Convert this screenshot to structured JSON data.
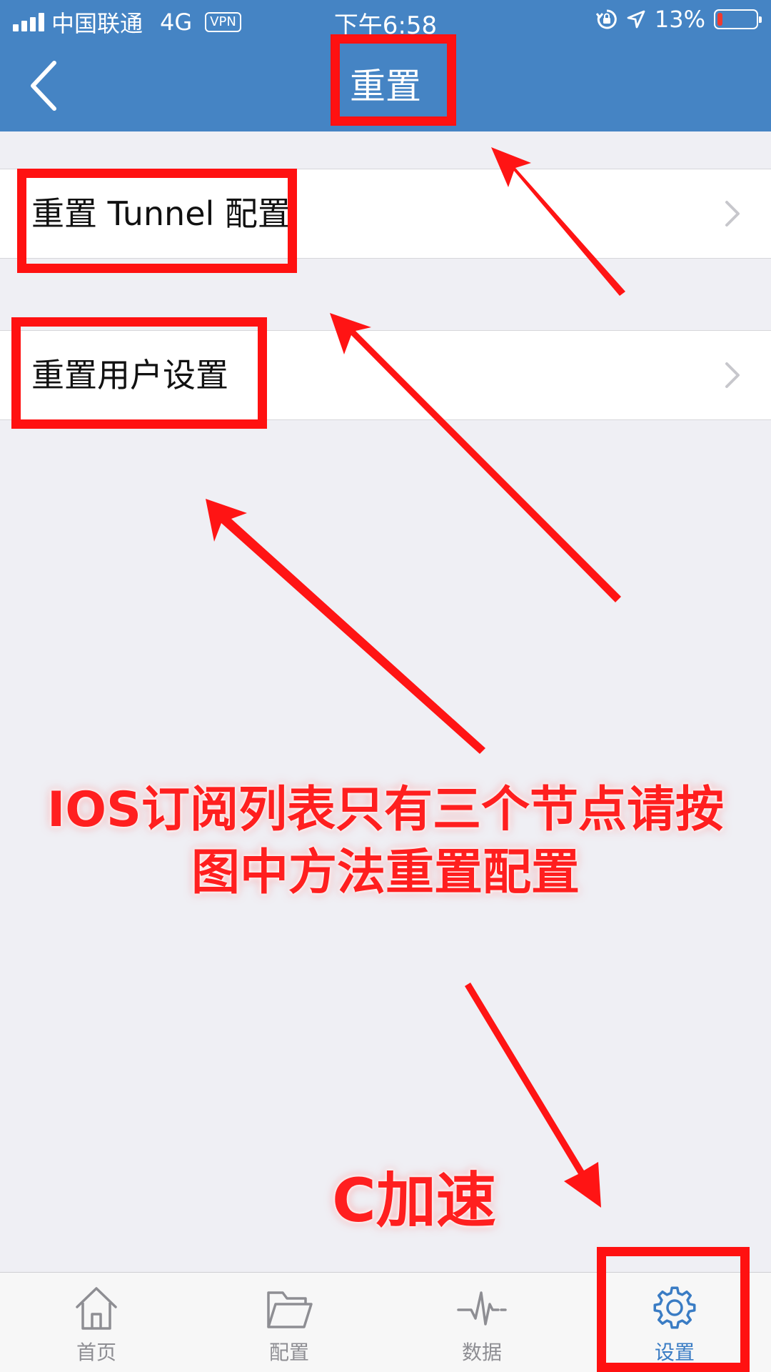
{
  "status_bar": {
    "carrier": "中国联通",
    "network": "4G",
    "vpn": "VPN",
    "time": "下午6:58",
    "battery_text": "13%",
    "battery_level": 0.13,
    "signal_bars": 4
  },
  "nav": {
    "title": "重置",
    "back_icon": "chevron-left-icon"
  },
  "list": {
    "items": [
      {
        "label": "重置 Tunnel 配置"
      },
      {
        "label": "重置用户设置"
      }
    ]
  },
  "annotations": {
    "instruction_line1": "IOS订阅列表只有三个节点请按",
    "instruction_line2": "图中方法重置配置",
    "brand": "C加速",
    "color": "#ff1f1f"
  },
  "tab_bar": {
    "tabs": [
      {
        "label": "首页",
        "icon": "home-icon"
      },
      {
        "label": "配置",
        "icon": "folder-icon"
      },
      {
        "label": "数据",
        "icon": "activity-icon"
      },
      {
        "label": "设置",
        "icon": "gear-icon",
        "active": true
      }
    ]
  },
  "colors": {
    "header": "#4584c4",
    "background": "#efeff4",
    "active_tab": "#3a7cc4",
    "inactive_tab": "#8e8e93",
    "annotation_red": "#ff1f1f"
  }
}
